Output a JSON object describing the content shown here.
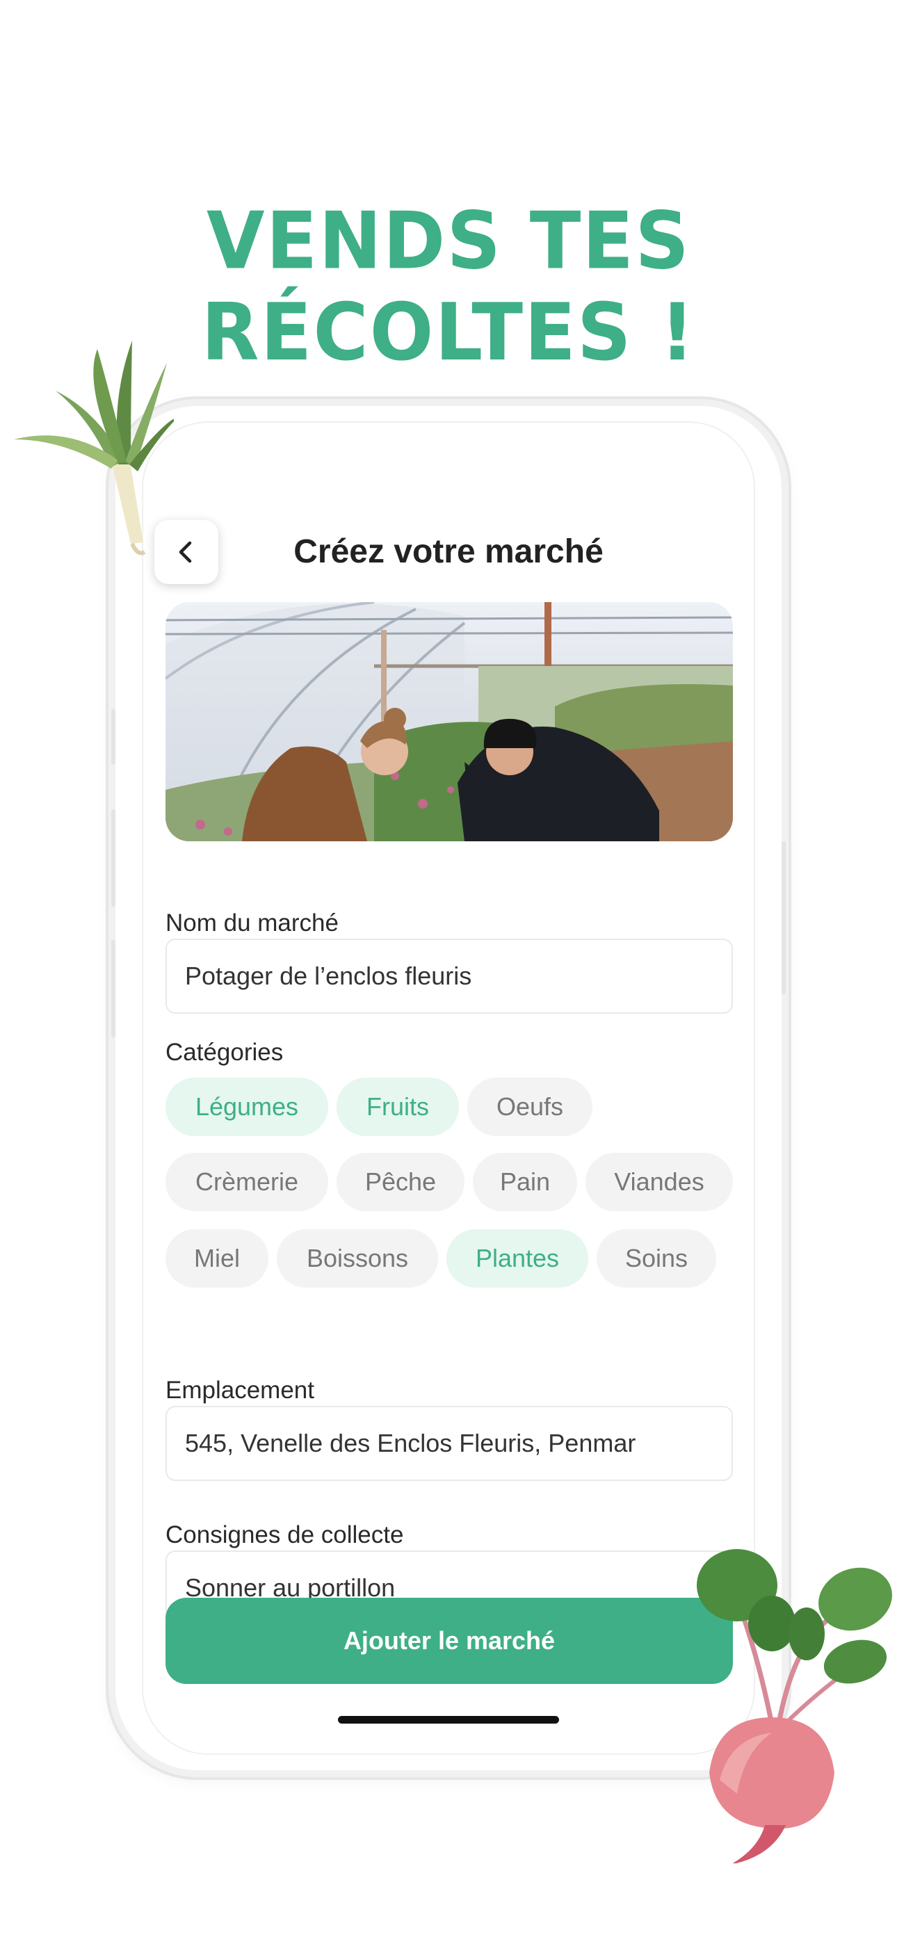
{
  "headline": "VENDS TES RÉCOLTES !",
  "screen": {
    "title": "Créez votre marché",
    "back_icon": "chevron-left-icon",
    "photo": "greenhouse-photo"
  },
  "form": {
    "name_label": "Nom du marché",
    "name_value": "Potager de l’enclos fleuris",
    "categories_label": "Catégories",
    "categories": [
      {
        "label": "Légumes",
        "selected": true
      },
      {
        "label": "Fruits",
        "selected": true
      },
      {
        "label": "Oeufs",
        "selected": false
      },
      {
        "label": "Crèmerie",
        "selected": false
      },
      {
        "label": "Pêche",
        "selected": false
      },
      {
        "label": "Pain",
        "selected": false
      },
      {
        "label": "Viandes",
        "selected": false
      },
      {
        "label": "Miel",
        "selected": false
      },
      {
        "label": "Boissons",
        "selected": false
      },
      {
        "label": "Plantes",
        "selected": true
      },
      {
        "label": "Soins",
        "selected": false
      }
    ],
    "location_label": "Emplacement",
    "location_value": "545, Venelle des Enclos Fleuris, Penmar",
    "pickup_label": "Consignes de collecte",
    "pickup_value": "Sonner au portillon"
  },
  "cta": {
    "label": "Ajouter le marché"
  },
  "colors": {
    "accent": "#3eaf86",
    "chip_selected_bg": "#e5f7ef",
    "chip_bg": "#f3f3f3"
  }
}
